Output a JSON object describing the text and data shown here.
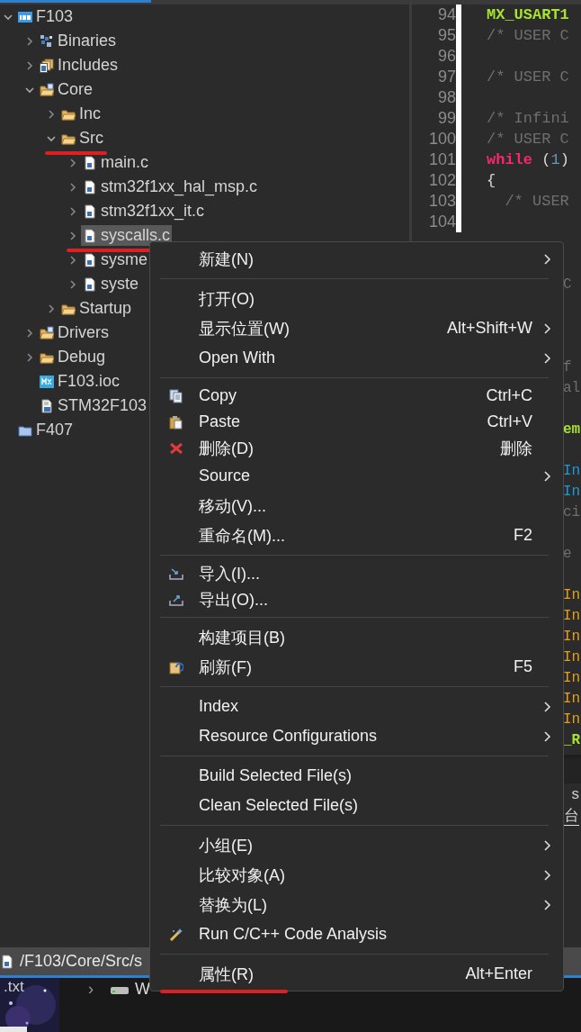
{
  "explorer": {
    "tree": [
      {
        "label": "F103",
        "kind": "project",
        "expanded": true,
        "selected": false,
        "underlined": false,
        "children": [
          {
            "label": "Binaries",
            "kind": "binaries",
            "expanded": false,
            "selected": false,
            "underlined": false
          },
          {
            "label": "Includes",
            "kind": "includes",
            "expanded": false,
            "selected": false,
            "underlined": false
          },
          {
            "label": "Core",
            "kind": "source-folder",
            "expanded": true,
            "selected": false,
            "underlined": false,
            "children": [
              {
                "label": "Inc",
                "kind": "folder",
                "expanded": false,
                "selected": false,
                "underlined": false
              },
              {
                "label": "Src",
                "kind": "folder",
                "expanded": true,
                "selected": false,
                "underlined": true,
                "children": [
                  {
                    "label": "main.c",
                    "kind": "c-file",
                    "expanded": false,
                    "selected": false,
                    "underlined": false
                  },
                  {
                    "label": "stm32f1xx_hal_msp.c",
                    "kind": "c-file",
                    "expanded": false,
                    "selected": false,
                    "underlined": false
                  },
                  {
                    "label": "stm32f1xx_it.c",
                    "kind": "c-file",
                    "expanded": false,
                    "selected": false,
                    "underlined": false
                  },
                  {
                    "label": "syscalls.c",
                    "kind": "c-file",
                    "expanded": false,
                    "selected": true,
                    "underlined": true
                  },
                  {
                    "label": "sysme",
                    "kind": "c-file",
                    "expanded": false,
                    "selected": false,
                    "underlined": false
                  },
                  {
                    "label": "syste",
                    "kind": "c-file",
                    "expanded": false,
                    "selected": false,
                    "underlined": false
                  }
                ]
              },
              {
                "label": "Startup",
                "kind": "folder",
                "expanded": false,
                "selected": false,
                "underlined": false
              }
            ]
          },
          {
            "label": "Drivers",
            "kind": "source-folder",
            "expanded": false,
            "selected": false,
            "underlined": false
          },
          {
            "label": "Debug",
            "kind": "folder",
            "expanded": false,
            "selected": false,
            "underlined": false
          },
          {
            "label": "F103.ioc",
            "kind": "ioc-file",
            "selected": false,
            "underlined": false
          },
          {
            "label": "STM32F103",
            "kind": "linker-file",
            "selected": false,
            "underlined": false
          }
        ]
      },
      {
        "label": "F407",
        "kind": "closed-project",
        "selected": false,
        "underlined": false
      }
    ]
  },
  "editor": {
    "lines": [
      {
        "kind": "code",
        "number": "94",
        "code": [
          {
            "text": "MX_USART1",
            "kind": "fn"
          }
        ]
      },
      {
        "kind": "code",
        "number": "95",
        "code": [
          {
            "text": "/* USER C",
            "kind": "comment"
          }
        ]
      },
      {
        "kind": "code",
        "number": "96"
      },
      {
        "kind": "code",
        "number": "97",
        "code": [
          {
            "text": "/* USER C",
            "kind": "comment"
          }
        ]
      },
      {
        "kind": "code",
        "number": "98"
      },
      {
        "kind": "code",
        "number": "99",
        "code": [
          {
            "text": "/* Infini",
            "kind": "comment"
          }
        ]
      },
      {
        "kind": "code",
        "number": "100",
        "code": [
          {
            "text": "/* USER C",
            "kind": "comment"
          }
        ]
      },
      {
        "kind": "code",
        "number": "101",
        "code": [
          {
            "text": "while",
            "kind": "keyword"
          },
          {
            "text": " (",
            "kind": "plain"
          },
          {
            "text": "1",
            "kind": "number"
          },
          {
            "text": ")",
            "kind": "plain"
          }
        ]
      },
      {
        "kind": "code",
        "number": "102",
        "code": [
          {
            "text": "{",
            "kind": "plain"
          }
        ]
      },
      {
        "kind": "code",
        "number": "103",
        "code": [
          {
            "text": "  /* USER",
            "kind": "comment"
          }
        ]
      },
      {
        "kind": "code",
        "number": "104"
      },
      {
        "kind": "blank"
      },
      {
        "kind": "blank"
      },
      {
        "kind": "tail",
        "code": [
          {
            "text": "C",
            "kind": "comment"
          }
        ]
      },
      {
        "kind": "blank"
      },
      {
        "kind": "blank"
      },
      {
        "kind": "blank"
      },
      {
        "kind": "tail",
        "code": [
          {
            "text": "f",
            "kind": "comment"
          }
        ]
      },
      {
        "kind": "tail",
        "code": [
          {
            "text": "al",
            "kind": "comment"
          }
        ]
      },
      {
        "kind": "blank"
      },
      {
        "kind": "tail",
        "code": [
          {
            "text": "em",
            "kind": "fn"
          }
        ]
      },
      {
        "kind": "blank"
      },
      {
        "kind": "tail",
        "code": [
          {
            "text": "In",
            "kind": "type"
          }
        ]
      },
      {
        "kind": "tail",
        "code": [
          {
            "text": "In",
            "kind": "type"
          }
        ]
      },
      {
        "kind": "tail",
        "code": [
          {
            "text": "ci",
            "kind": "comment"
          }
        ]
      },
      {
        "kind": "blank"
      },
      {
        "kind": "tail",
        "code": [
          {
            "text": "e",
            "kind": "comment"
          }
        ]
      },
      {
        "kind": "blank"
      },
      {
        "kind": "tail",
        "code": [
          {
            "text": "In",
            "kind": "macro"
          }
        ]
      },
      {
        "kind": "tail",
        "code": [
          {
            "text": "In",
            "kind": "macro"
          }
        ]
      },
      {
        "kind": "tail",
        "code": [
          {
            "text": "In",
            "kind": "macro"
          }
        ]
      },
      {
        "kind": "tail",
        "code": [
          {
            "text": "In",
            "kind": "macro"
          }
        ]
      },
      {
        "kind": "tail",
        "code": [
          {
            "text": "In",
            "kind": "macro"
          }
        ]
      },
      {
        "kind": "tail",
        "code": [
          {
            "text": "In",
            "kind": "macro"
          }
        ]
      },
      {
        "kind": "tail",
        "code": [
          {
            "text": "In",
            "kind": "macro"
          }
        ]
      },
      {
        "kind": "tail",
        "code": [
          {
            "text": "_R",
            "kind": "fn"
          }
        ]
      }
    ]
  },
  "bottom_panel": {
    "tabs": [
      {
        "label": "s",
        "selected": false
      },
      {
        "label": "台",
        "selected": true
      }
    ]
  },
  "path_bar": {
    "path": "/F103/Core/Src/s"
  },
  "desktop": {
    "file_label": ".txt",
    "crumb": "›",
    "drive_label": "W"
  },
  "context_menu": {
    "items": [
      {
        "kind": "item",
        "label": "新建(N)",
        "submenu": true,
        "underlined": false
      },
      {
        "kind": "separator"
      },
      {
        "kind": "item",
        "label": "打开(O)",
        "submenu": false,
        "underlined": false
      },
      {
        "kind": "item",
        "label": "显示位置(W)",
        "shortcut": "Alt+Shift+W",
        "submenu": true,
        "underlined": false
      },
      {
        "kind": "item",
        "label": "Open With",
        "submenu": true,
        "underlined": false
      },
      {
        "kind": "separator"
      },
      {
        "kind": "copy",
        "label": "Copy",
        "shortcut": "Ctrl+C",
        "submenu": false,
        "underlined": false
      },
      {
        "kind": "paste",
        "label": "Paste",
        "shortcut": "Ctrl+V",
        "submenu": false,
        "underlined": false
      },
      {
        "kind": "delete",
        "label": "删除(D)",
        "shortcut": "删除",
        "submenu": false,
        "underlined": false
      },
      {
        "kind": "item",
        "label": "Source",
        "submenu": true,
        "underlined": false
      },
      {
        "kind": "item",
        "label": "移动(V)...",
        "submenu": false,
        "underlined": false
      },
      {
        "kind": "item",
        "label": "重命名(M)...",
        "shortcut": "F2",
        "submenu": false,
        "underlined": false
      },
      {
        "kind": "separator"
      },
      {
        "kind": "import",
        "label": "导入(I)...",
        "submenu": false,
        "underlined": false
      },
      {
        "kind": "export",
        "label": "导出(O)...",
        "submenu": false,
        "underlined": false
      },
      {
        "kind": "separator"
      },
      {
        "kind": "item",
        "label": "构建项目(B)",
        "submenu": false,
        "underlined": false
      },
      {
        "kind": "refresh",
        "label": "刷新(F)",
        "shortcut": "F5",
        "submenu": false,
        "underlined": false
      },
      {
        "kind": "separator"
      },
      {
        "kind": "item",
        "label": "Index",
        "submenu": true,
        "underlined": false
      },
      {
        "kind": "item",
        "label": "Resource Configurations",
        "submenu": true,
        "underlined": false
      },
      {
        "kind": "separator"
      },
      {
        "kind": "item",
        "label": "Build Selected File(s)",
        "submenu": false,
        "underlined": false
      },
      {
        "kind": "item",
        "label": "Clean Selected File(s)",
        "submenu": false,
        "underlined": false
      },
      {
        "kind": "separator"
      },
      {
        "kind": "item",
        "label": "小组(E)",
        "submenu": true,
        "underlined": false
      },
      {
        "kind": "item",
        "label": "比较对象(A)",
        "submenu": true,
        "underlined": false
      },
      {
        "kind": "item",
        "label": "替换为(L)",
        "submenu": true,
        "underlined": false
      },
      {
        "kind": "analysis",
        "label": "Run C/C++ Code Analysis",
        "submenu": false,
        "underlined": false
      },
      {
        "kind": "separator"
      },
      {
        "kind": "item",
        "label": "属性(R)",
        "shortcut": "Alt+Enter",
        "submenu": false,
        "underlined": true
      }
    ]
  }
}
